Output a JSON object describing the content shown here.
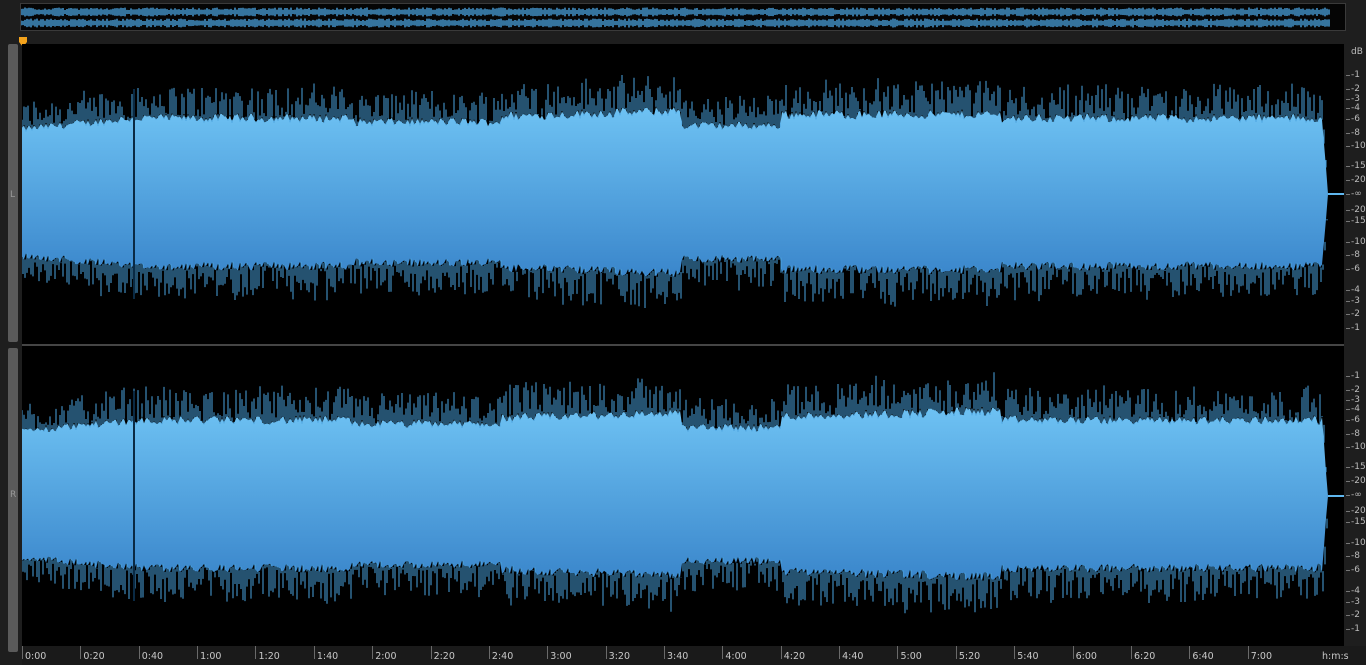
{
  "channels": [
    {
      "label": "L"
    },
    {
      "label": "R"
    }
  ],
  "db_scale": {
    "unit": "dB",
    "labels": [
      "-1",
      "-2",
      "-3",
      "-4",
      "-6",
      "-8",
      "-10",
      "-15",
      "-20",
      "-∞",
      "-20",
      "-15",
      "-10",
      "-8",
      "-6",
      "-4",
      "-3",
      "-2",
      "-1"
    ]
  },
  "timeline": {
    "unit": "h:m:s",
    "labels": [
      "0:00",
      "0:20",
      "0:40",
      "1:00",
      "1:20",
      "1:40",
      "2:00",
      "2:20",
      "2:40",
      "3:00",
      "3:20",
      "3:40",
      "4:00",
      "4:20",
      "4:40",
      "5:00",
      "5:20",
      "5:40",
      "6:00",
      "6:20",
      "6:40",
      "7:00"
    ],
    "duration_seconds": 453
  },
  "colors": {
    "waveform_top": "#5fb6ee",
    "waveform_bottom": "#3f8fd2",
    "background": "#000000",
    "playhead": "#f4a31c"
  }
}
